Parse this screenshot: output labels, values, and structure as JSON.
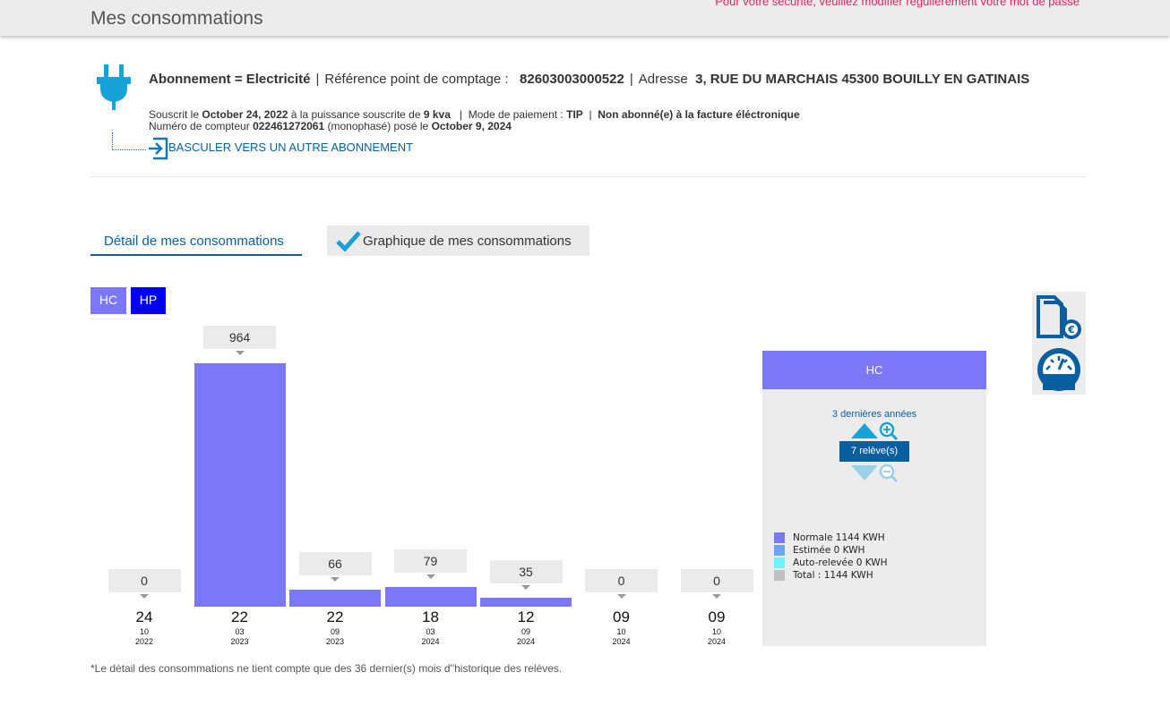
{
  "header": {
    "title": "Mes consommations",
    "security_notice": "Pour votre sécurité, veuillez modifier régulièrement votre mot de passe"
  },
  "subscription": {
    "type_label": "Abonnement = Electricité",
    "ref_label": "Référence point de comptage :",
    "ref_value": "82603003000522",
    "address_label": "Adresse",
    "address_value": "3, RUE DU MARCHAIS 45300 BOUILLY EN GATINAIS",
    "subscribed_prefix": "Souscrit le",
    "subscribed_date": "October 24, 2022",
    "power_prefix": "à la puissance souscrite de",
    "power_value": "9 kva",
    "payment_label": "Mode de paiement :",
    "payment_value": "TIP",
    "einvoice_status": "Non abonné(e) à la facture éléctronique",
    "meter_prefix": "Numéro de compteur",
    "meter_number": "022461272061",
    "meter_phase": "(monophasé) posé le",
    "meter_date": "October 9, 2024",
    "switch_link": "BASCULER VERS UN AUTRE ABONNEMENT"
  },
  "tabs": [
    {
      "label": "Détail de mes consommations",
      "active": false
    },
    {
      "label": "Graphique de mes consommations",
      "active": true
    }
  ],
  "rate_buttons": {
    "hc": "HC",
    "hp": "HP"
  },
  "chart_data": {
    "type": "bar",
    "title": "",
    "series": [
      {
        "name": "HC",
        "values": [
          0,
          964,
          66,
          79,
          35,
          0,
          0
        ]
      }
    ],
    "categories": [
      {
        "day": "24",
        "month": "10",
        "year": "2022"
      },
      {
        "day": "22",
        "month": "03",
        "year": "2023"
      },
      {
        "day": "22",
        "month": "09",
        "year": "2023"
      },
      {
        "day": "18",
        "month": "03",
        "year": "2024"
      },
      {
        "day": "12",
        "month": "09",
        "year": "2024"
      },
      {
        "day": "09",
        "month": "10",
        "year": "2024"
      },
      {
        "day": "09",
        "month": "10",
        "year": "2024"
      }
    ],
    "value_labels": [
      "0",
      "964",
      "66",
      "79",
      "35",
      "0",
      "0"
    ],
    "ylim": [
      0,
      964
    ],
    "bar_color": "#7b78f7",
    "grid": false
  },
  "panel": {
    "title": "HC",
    "period": "3 dernières années",
    "releves": "7 relève(s)",
    "legend": [
      {
        "label": "Normale 1144 KWH",
        "color": "#7b78f7"
      },
      {
        "label": "Estimée 0 KWH",
        "color": "#6aa6f2"
      },
      {
        "label": "Auto-relevée 0 KWH",
        "color": "#6cf2f7"
      },
      {
        "label": "Total : 1144 KWH",
        "color": "#c0c0c0"
      }
    ]
  },
  "footnote": "*Le détail des consommations ne tient compte que des 36 dernier(s) mois d''historique des relèves."
}
